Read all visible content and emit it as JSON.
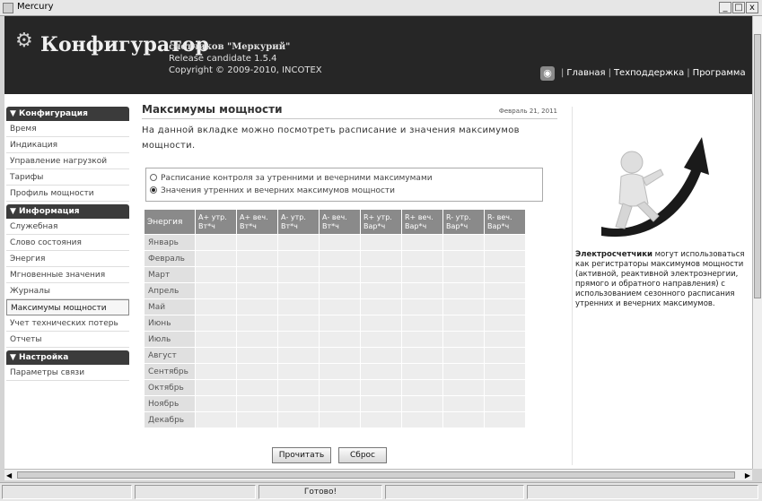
{
  "window": {
    "title": "Mercury",
    "min": "_",
    "max": "□",
    "close": "x"
  },
  "header": {
    "title": "Конфигуратор",
    "subtitle1": "счетчиков \"Меркурий\"",
    "subtitle2": "Release candidate 1.5.4",
    "subtitle3": "Copyright © 2009-2010, INCOTEX",
    "nav": [
      "Главная",
      "Техподдержка",
      "Программа"
    ]
  },
  "sidebar": {
    "sections": [
      {
        "title": "▼ Конфигурация",
        "items": [
          "Время",
          "Индикация",
          "Управление нагрузкой",
          "Тарифы",
          "Профиль мощности"
        ]
      },
      {
        "title": "▼ Информация",
        "items": [
          "Служебная",
          "Слово состояния",
          "Энергия",
          "Мгновенные значения",
          "Журналы",
          "Максимумы мощности",
          "Учет технических потерь",
          "Отчеты"
        ]
      },
      {
        "title": "▼ Настройка",
        "items": [
          "Параметры связи"
        ]
      }
    ],
    "active": "Максимумы мощности"
  },
  "main": {
    "title": "Максимумы мощности",
    "date": "Февраль 21, 2011",
    "description": "На данной вкладке можно посмотреть расписание и значения максимумов мощности.",
    "radio1": "Расписание контроля за утренними и вечерними максимумами",
    "radio2": "Значения утренних и вечерних максимумов мощности",
    "table_headers": [
      "Энергия",
      "А+ утр. Вт*ч",
      "А+ веч. Вт*ч",
      "А- утр. Вт*ч",
      "А- веч. Вт*ч",
      "R+ утр. Вар*ч",
      "R+ веч. Вар*ч",
      "R- утр. Вар*ч",
      "R- веч. Вар*ч"
    ],
    "months": [
      "Январь",
      "Февраль",
      "Март",
      "Апрель",
      "Май",
      "Июнь",
      "Июль",
      "Август",
      "Сентябрь",
      "Октябрь",
      "Ноябрь",
      "Декабрь"
    ],
    "read_button": "Прочитать",
    "reset_button": "Сброс"
  },
  "promo": {
    "bold": "Электросчетчики",
    "text": " могут использоваться как регистраторы максимумов мощности (активной, реактивной электроэнергии, прямого и обратного направления) с использованием сезонного расписания утренних и вечерних максимумов."
  },
  "status": {
    "text": "Готово!"
  }
}
